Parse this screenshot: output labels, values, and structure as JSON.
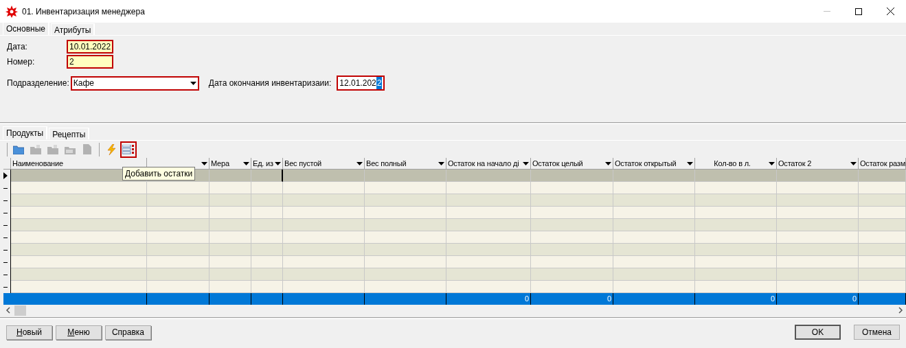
{
  "window": {
    "title": "01. Инвентаризация менеджера"
  },
  "tabs": [
    {
      "label": "Основные",
      "selected": true
    },
    {
      "label": "Атрибуты",
      "selected": false
    }
  ],
  "form": {
    "date": {
      "label": "Дата:",
      "value": "10.01.2022",
      "highlighted": true,
      "required": true
    },
    "number": {
      "label": "Номер:",
      "value": "2",
      "highlighted": true,
      "required": true
    },
    "department": {
      "label": "Подразделение:",
      "value": "Кафе",
      "required": true
    },
    "end_date": {
      "label": "Дата окончания инвентаризаии:",
      "value": "12.01.202",
      "selection": "2",
      "required": true
    }
  },
  "detail_tabs": [
    {
      "label": "Продукты",
      "selected": true
    },
    {
      "label": "Рецепты",
      "selected": false
    }
  ],
  "toolbar": [
    {
      "kind": "folder",
      "disabled": false,
      "selected": false
    },
    {
      "kind": "folder-up",
      "disabled": true,
      "selected": false
    },
    {
      "kind": "folder-edit",
      "disabled": true,
      "selected": false
    },
    {
      "kind": "folder-copy",
      "disabled": true,
      "selected": false
    },
    {
      "kind": "document",
      "disabled": true,
      "selected": false
    },
    {
      "kind": "separator"
    },
    {
      "kind": "lightning",
      "disabled": false,
      "selected": false
    },
    {
      "kind": "list",
      "disabled": false,
      "selected": true
    }
  ],
  "tooltip": "Добавить остатки",
  "table": {
    "columns": [
      {
        "label": "Наименование",
        "filter": false,
        "centered": false
      },
      {
        "filter": true,
        "centered": false
      },
      {
        "label": "Мера",
        "filter": true,
        "centered": false
      },
      {
        "label": "Ед. из",
        "filter": true,
        "centered": false
      },
      {
        "label": "Вес пустой",
        "filter": true,
        "centered": false
      },
      {
        "label": "Вес полный",
        "filter": true,
        "centered": false
      },
      {
        "label": "Остаток на начало ді",
        "filter": true,
        "centered": false,
        "total": "0"
      },
      {
        "label": "Остаток целый",
        "filter": true,
        "centered": false,
        "total": "0"
      },
      {
        "label": "Остаток открытый",
        "filter": true,
        "centered": false
      },
      {
        "label": "Кол-во в л.",
        "filter": true,
        "centered": true,
        "total": "0"
      },
      {
        "label": "Остаток 2",
        "filter": true,
        "centered": false,
        "total": "0"
      },
      {
        "label": "Остаток разм",
        "centered": false
      }
    ],
    "rows": [
      {
        "selected": true
      },
      {
        "selected": false
      },
      {
        "selected": false
      },
      {
        "selected": false
      },
      {
        "selected": false
      },
      {
        "selected": false
      },
      {
        "selected": false
      },
      {
        "selected": false
      },
      {
        "selected": false
      },
      {
        "selected": false
      }
    ]
  },
  "buttons_left": [
    {
      "label": "Новый",
      "access_key": true
    },
    {
      "label": "Меню",
      "access_key": true
    },
    {
      "label": "Справка",
      "access_key": false
    }
  ],
  "buttons_right": [
    {
      "label": "OK",
      "default": true
    },
    {
      "label": "Отмена",
      "default": false
    }
  ]
}
